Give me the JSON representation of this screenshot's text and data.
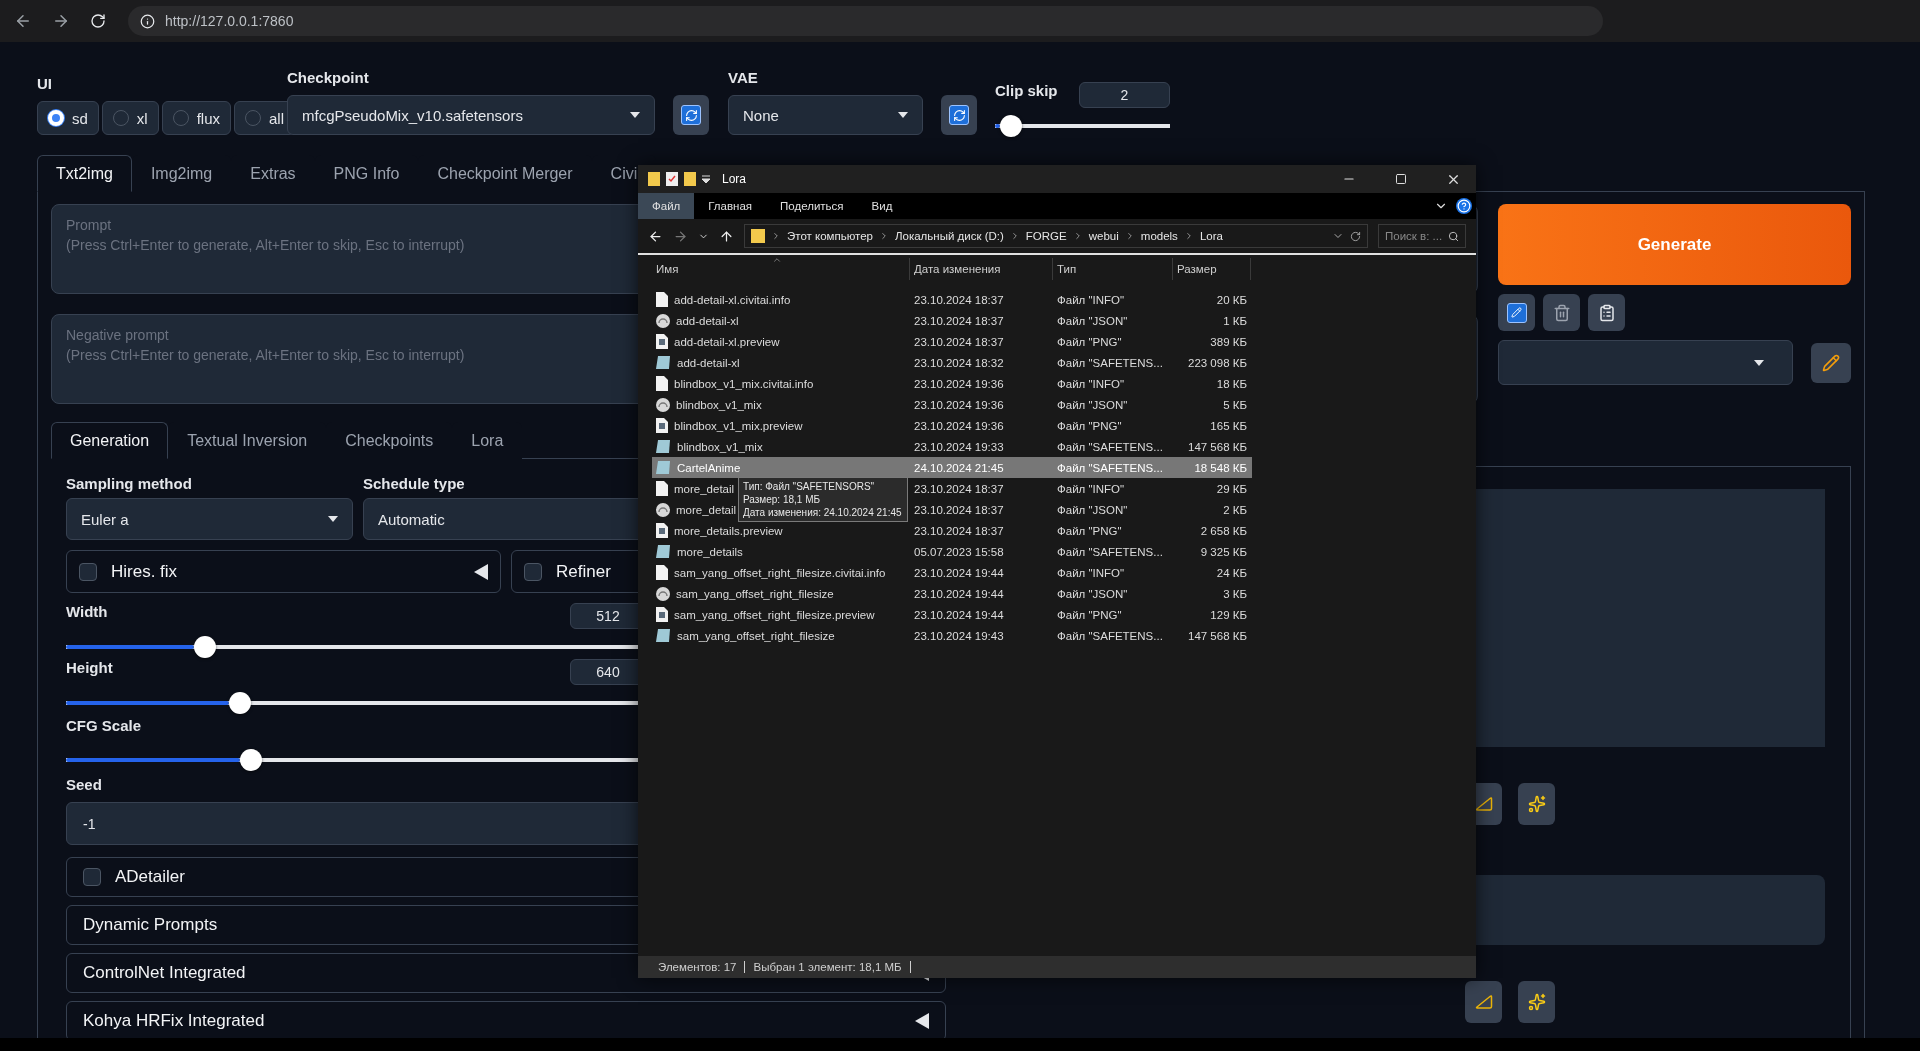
{
  "browser": {
    "url": "http://127.0.0.1:7860"
  },
  "header": {
    "ui": {
      "label": "UI",
      "options": [
        {
          "label": "sd",
          "selected": true
        },
        {
          "label": "xl",
          "selected": false
        },
        {
          "label": "flux",
          "selected": false
        },
        {
          "label": "all",
          "selected": false
        }
      ]
    },
    "checkpoint": {
      "label": "Checkpoint",
      "value": "mfcgPseudoMix_v10.safetensors"
    },
    "vae": {
      "label": "VAE",
      "value": "None"
    },
    "clip_skip": {
      "label": "Clip skip",
      "value": "2",
      "level": 0.09
    }
  },
  "tabs": [
    {
      "label": "Txt2img",
      "selected": true
    },
    {
      "label": "Img2img",
      "selected": false
    },
    {
      "label": "Extras",
      "selected": false
    },
    {
      "label": "PNG Info",
      "selected": false
    },
    {
      "label": "Checkpoint Merger",
      "selected": false
    },
    {
      "label": "Civi",
      "selected": false
    }
  ],
  "prompt": {
    "placeholder": "Prompt\n(Press Ctrl+Enter to generate, Alt+Enter to skip, Esc to interrupt)"
  },
  "negative_prompt": {
    "placeholder": "Negative prompt\n(Press Ctrl+Enter to generate, Alt+Enter to skip, Esc to interrupt)"
  },
  "actions": {
    "generate": "Generate"
  },
  "settings": {
    "tabs": [
      {
        "label": "Generation",
        "selected": true
      },
      {
        "label": "Textual Inversion",
        "selected": false
      },
      {
        "label": "Checkpoints",
        "selected": false
      },
      {
        "label": "Lora",
        "selected": false
      }
    ],
    "sampling_method": {
      "label": "Sampling method",
      "value": "Euler a"
    },
    "schedule_type": {
      "label": "Schedule type",
      "value": "Automatic"
    },
    "toggles": [
      {
        "label": "Hires. fix",
        "checked": false
      },
      {
        "label": "Refiner",
        "checked": false
      }
    ],
    "sliders": [
      {
        "label": "Width",
        "value": "512",
        "level": 0.24
      },
      {
        "label": "Height",
        "value": "640",
        "level": 0.3
      }
    ],
    "cfg": {
      "label": "CFG Scale",
      "level": 0.21
    },
    "seed": {
      "label": "Seed",
      "value": "-1"
    },
    "sections": [
      {
        "label": "ADetailer",
        "kind": "checkbox",
        "checked": false
      },
      {
        "label": "Dynamic Prompts",
        "kind": "plain"
      },
      {
        "label": "ControlNet Integrated",
        "kind": "plain"
      },
      {
        "label": "Kohya HRFix Integrated",
        "kind": "plain"
      }
    ]
  },
  "explorer": {
    "title": "Lora",
    "ribbon_tabs": [
      {
        "label": "Файл",
        "selected": true
      },
      {
        "label": "Главная",
        "selected": false
      },
      {
        "label": "Поделиться",
        "selected": false
      },
      {
        "label": "Вид",
        "selected": false
      }
    ],
    "breadcrumb": [
      "Этот компьютер",
      "Локальный диск (D:)",
      "FORGE",
      "webui",
      "models",
      "Lora"
    ],
    "search": {
      "placeholder": "Поиск в: ..."
    },
    "columns": [
      "Имя",
      "Дата изменения",
      "Тип",
      "Размер"
    ],
    "files": [
      {
        "name": "add-detail-xl.civitai.info",
        "modified": "23.10.2024 18:37",
        "type": "Файл \"INFO\"",
        "size": "20 КБ",
        "kind": "info",
        "selected": false
      },
      {
        "name": "add-detail-xl",
        "modified": "23.10.2024 18:37",
        "type": "Файл \"JSON\"",
        "size": "1 КБ",
        "kind": "json",
        "selected": false
      },
      {
        "name": "add-detail-xl.preview",
        "modified": "23.10.2024 18:37",
        "type": "Файл \"PNG\"",
        "size": "389 КБ",
        "kind": "png",
        "selected": false
      },
      {
        "name": "add-detail-xl",
        "modified": "23.10.2024 18:32",
        "type": "Файл \"SAFETENS...",
        "size": "223 098 КБ",
        "kind": "model",
        "selected": false
      },
      {
        "name": "blindbox_v1_mix.civitai.info",
        "modified": "23.10.2024 19:36",
        "type": "Файл \"INFO\"",
        "size": "18 КБ",
        "kind": "info",
        "selected": false
      },
      {
        "name": "blindbox_v1_mix",
        "modified": "23.10.2024 19:36",
        "type": "Файл \"JSON\"",
        "size": "5 КБ",
        "kind": "json",
        "selected": false
      },
      {
        "name": "blindbox_v1_mix.preview",
        "modified": "23.10.2024 19:36",
        "type": "Файл \"PNG\"",
        "size": "165 КБ",
        "kind": "png",
        "selected": false
      },
      {
        "name": "blindbox_v1_mix",
        "modified": "23.10.2024 19:33",
        "type": "Файл \"SAFETENS...",
        "size": "147 568 КБ",
        "kind": "model",
        "selected": false
      },
      {
        "name": "CartelAnime",
        "modified": "24.10.2024 21:45",
        "type": "Файл \"SAFETENS...",
        "size": "18 548 КБ",
        "kind": "model",
        "selected": true
      },
      {
        "name": "more_detail",
        "modified": "23.10.2024 18:37",
        "type": "Файл \"INFO\"",
        "size": "29 КБ",
        "kind": "info",
        "selected": false
      },
      {
        "name": "more_detail",
        "modified": "23.10.2024 18:37",
        "type": "Файл \"JSON\"",
        "size": "2 КБ",
        "kind": "json",
        "selected": false
      },
      {
        "name": "more_details.preview",
        "modified": "23.10.2024 18:37",
        "type": "Файл \"PNG\"",
        "size": "2 658 КБ",
        "kind": "png",
        "selected": false
      },
      {
        "name": "more_details",
        "modified": "05.07.2023 15:58",
        "type": "Файл \"SAFETENS...",
        "size": "9 325 КБ",
        "kind": "model",
        "selected": false
      },
      {
        "name": "sam_yang_offset_right_filesize.civitai.info",
        "modified": "23.10.2024 19:44",
        "type": "Файл \"INFO\"",
        "size": "24 КБ",
        "kind": "info",
        "selected": false
      },
      {
        "name": "sam_yang_offset_right_filesize",
        "modified": "23.10.2024 19:44",
        "type": "Файл \"JSON\"",
        "size": "3 КБ",
        "kind": "json",
        "selected": false
      },
      {
        "name": "sam_yang_offset_right_filesize.preview",
        "modified": "23.10.2024 19:44",
        "type": "Файл \"PNG\"",
        "size": "129 КБ",
        "kind": "png",
        "selected": false
      },
      {
        "name": "sam_yang_offset_right_filesize",
        "modified": "23.10.2024 19:43",
        "type": "Файл \"SAFETENS...",
        "size": "147 568 КБ",
        "kind": "model",
        "selected": false
      }
    ],
    "tooltip": [
      "Тип: Файл \"SAFETENSORS\"",
      "Размер: 18,1 МБ",
      "Дата изменения: 24.10.2024 21:45"
    ],
    "status": [
      "Элементов: 17",
      "Выбран 1 элемент: 18,1 МБ"
    ]
  }
}
